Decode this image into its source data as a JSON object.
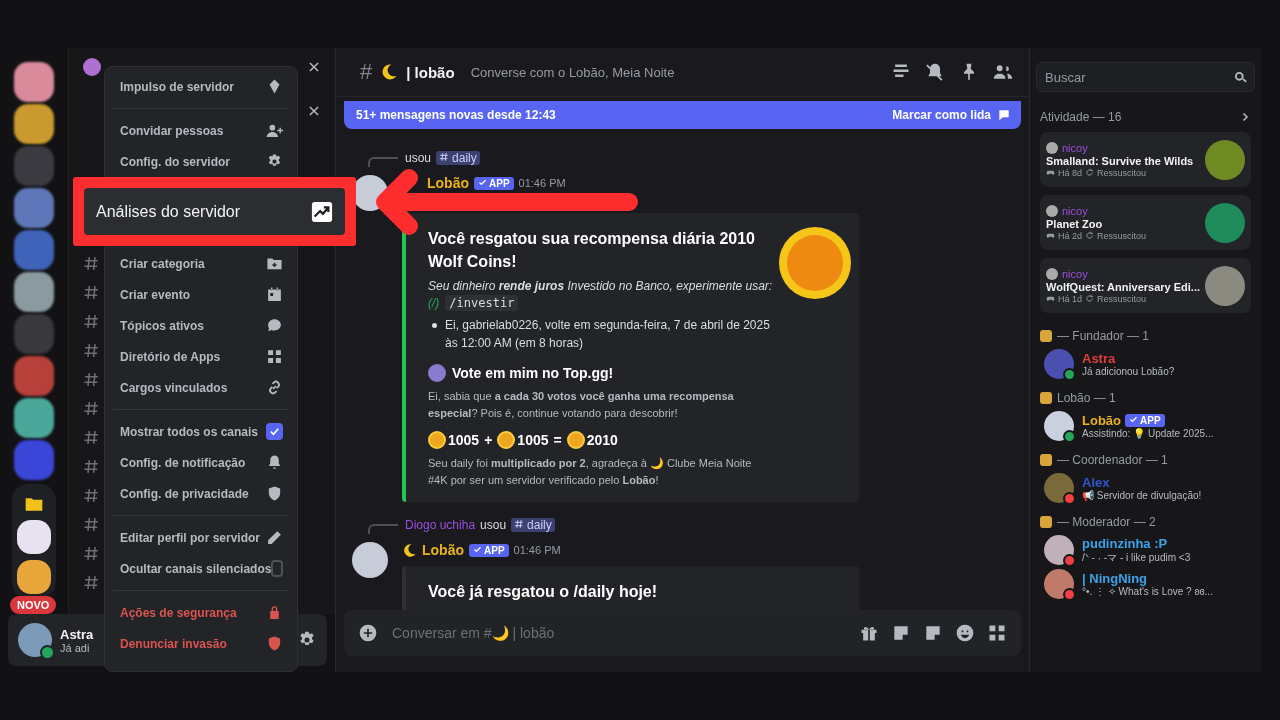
{
  "server_rail": {
    "new_badge": "NOVO"
  },
  "user_panel": {
    "name": "Astra",
    "status": "Já adi"
  },
  "context_menu": {
    "groups": [
      [
        {
          "kind": "action",
          "label": "Impulso de servidor"
        }
      ],
      [
        {
          "kind": "action",
          "label": "Convidar pessoas"
        },
        {
          "kind": "action",
          "label": "Config. do servidor"
        },
        {
          "kind": "highlighted",
          "label": "Análises do servidor"
        },
        {
          "kind": "action",
          "label": "Criar categoria"
        },
        {
          "kind": "action",
          "label": "Criar evento"
        },
        {
          "kind": "action",
          "label": "Tópicos ativos"
        },
        {
          "kind": "action",
          "label": "Diretório de Apps"
        },
        {
          "kind": "action",
          "label": "Cargos vinculados"
        }
      ],
      [
        {
          "kind": "checkbox",
          "label": "Mostrar todos os canais",
          "checked": true
        },
        {
          "kind": "action",
          "label": "Config. de notificação"
        },
        {
          "kind": "action",
          "label": "Config. de privacidade"
        }
      ],
      [
        {
          "kind": "action",
          "label": "Editar perfil por servidor"
        },
        {
          "kind": "checkbox",
          "label": "Ocultar canais silenciados",
          "checked": false
        }
      ],
      [
        {
          "kind": "danger",
          "label": "Ações de segurança"
        },
        {
          "kind": "danger",
          "label": "Denunciar invasão"
        }
      ]
    ]
  },
  "channel_header": {
    "hash": "#",
    "name": "| lobão",
    "topic": "Converse com o Lobão, Meia Noite"
  },
  "new_messages_banner": {
    "text": "51+ mensagens novas desde 12:43",
    "action": "Marcar como lida"
  },
  "messages": [
    {
      "reply_verb": "usou",
      "reply_command": "daily",
      "author_emoji_shown": false,
      "author": "Lobão",
      "badge": "APP",
      "time": "01:46 PM",
      "embed": {
        "title": "Você resgatou sua recompensa diária 2010 Wolf Coins!",
        "lines": [
          {
            "kind": "note",
            "text": "Seu dinheiro **rende juros** Investido no Banco, experimente usar:"
          },
          {
            "kind": "command",
            "prefix": "(/)",
            "text": "/investir"
          },
          {
            "kind": "bullet",
            "text": "Ei, gabrielab0226, volte em segunda-feira, 7 de abril de 2025 às 12:00 AM (em 8 horas)"
          },
          {
            "kind": "heading",
            "text": "Vote em mim no Top.gg!"
          },
          {
            "kind": "small",
            "text": "Ei, sabia que **a cada 30 votos você ganha uma recompensa especial**? Pois é, continue votando para descobrir!"
          },
          {
            "kind": "coins",
            "terms": [
              {
                "value": "1005",
                "op": "+"
              },
              {
                "value": "1005",
                "op": "="
              },
              {
                "value": "2010"
              }
            ]
          },
          {
            "kind": "small",
            "text": "Seu daily foi **multiplicado por 2**, agradeça à 🌙 Clube Meia Noite #4K por ser um servidor verificado pelo **Lobão**!"
          }
        ]
      }
    },
    {
      "reply_user": "Diogo uchiha",
      "reply_verb": "usou",
      "reply_command": "daily",
      "author_emoji_shown": true,
      "author": "Lobão",
      "badge": "APP",
      "time": "01:46 PM",
      "embed": {
        "title": "Você já resgatou o /daily hoje!"
      }
    }
  ],
  "composer": {
    "placeholder": "Conversar em #🌙 | lobão"
  },
  "member_list": {
    "search": {
      "placeholder": "Buscar"
    },
    "activity": {
      "heading": "Atividade — 16",
      "cards": [
        {
          "user": "nicoy",
          "game": "Smalland: Survive the Wilds",
          "ago": "Há 8d",
          "status": "Ressuscitou"
        },
        {
          "user": "nicoy",
          "game": "Planet Zoo",
          "ago": "Há 2d",
          "status": "Ressuscitou"
        },
        {
          "user": "nicoy",
          "game": "WolfQuest: Anniversary Edi...",
          "ago": "Há 1d",
          "status": "Ressuscitou"
        }
      ]
    },
    "groups": [
      {
        "title": "— Fundador — 1",
        "members": [
          {
            "name": "Astra",
            "color": "#e03c3c",
            "status_text": "Já adicionou Lobão?",
            "dnd": false
          }
        ]
      },
      {
        "title": "Lobão — 1",
        "members": [
          {
            "name": "Lobão",
            "badge": "APP",
            "color": "#e9b21a",
            "status_text": "Assistindo: 💡 Update 2025...",
            "dnd": false
          }
        ]
      },
      {
        "title": "— Coordenador — 1",
        "members": [
          {
            "name": "Alex",
            "color": "#2f55c8",
            "status_text": "📢 Servidor de divulgação!",
            "dnd": true
          }
        ]
      },
      {
        "title": "— Moderador — 2",
        "members": [
          {
            "name": "pudinzinha :P",
            "color": "#3ba2ea",
            "status_text": "/ᐠ - ˕ -マ - i like pudim <3",
            "dnd": true
          },
          {
            "name": "| NingNing",
            "color": "#3ba2ea",
            "status_text": "°•. ⋮ ✧ What's is Love ? ʚɞ...",
            "dnd": true
          }
        ]
      }
    ]
  }
}
